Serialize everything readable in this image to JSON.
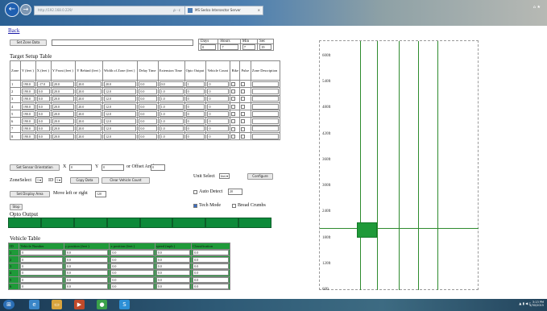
{
  "browser": {
    "address": "http://192.168.0.229/",
    "address_controls": "ρ - c",
    "tab_title": "MS Sedco Intersector Server",
    "tab_close": "×",
    "back_glyph": "←",
    "forward_glyph": "→",
    "window_controls": "⌂ ★"
  },
  "page": {
    "back_link": "Back",
    "set_zone_data_label": "Set Zone Data",
    "zone_data_value": "",
    "time_headers": [
      "Days",
      "Hours",
      "Min",
      "Sec"
    ],
    "time_values": [
      "0",
      "7",
      "7",
      "19"
    ],
    "target_setup_title": "Target Setup Table",
    "target_headers": [
      "Zone",
      "Y (feet )",
      "X (feet )",
      "Y Front (feet )",
      "Y Behind (feet )",
      "Width of Zone (feet )",
      "Delay Time",
      "Extension Time",
      "Opto Output",
      "Vehicle Count",
      "Bike",
      "Pulse",
      "Zone Description"
    ],
    "target_rows": [
      {
        "zone": "1",
        "y": "190.0",
        "x": "-17.0",
        "yfront": "20.0",
        "ybehind": "20.0",
        "width": "20.0",
        "delay": "0.0",
        "ext": "0.0",
        "opto": "1",
        "count": "0",
        "desc": ""
      },
      {
        "zone": "2",
        "y": "190.0",
        "x": "0.0",
        "yfront": "20.0",
        "ybehind": "20.0",
        "width": "12.0",
        "delay": "0.0",
        "ext": "1.0",
        "opto": "0",
        "count": "0",
        "desc": ""
      },
      {
        "zone": "3",
        "y": "190.0",
        "x": "0.0",
        "yfront": "20.0",
        "ybehind": "20.0",
        "width": "12.0",
        "delay": "0.0",
        "ext": "1.0",
        "opto": "0",
        "count": "0",
        "desc": ""
      },
      {
        "zone": "4",
        "y": "190.0",
        "x": "0.0",
        "yfront": "20.0",
        "ybehind": "20.0",
        "width": "12.0",
        "delay": "0.0",
        "ext": "1.0",
        "opto": "0",
        "count": "0",
        "desc": ""
      },
      {
        "zone": "5",
        "y": "190.0",
        "x": "0.0",
        "yfront": "20.0",
        "ybehind": "20.0",
        "width": "12.0",
        "delay": "0.0",
        "ext": "1.0",
        "opto": "0",
        "count": "0",
        "desc": ""
      },
      {
        "zone": "6",
        "y": "190.0",
        "x": "0.0",
        "yfront": "20.0",
        "ybehind": "20.0",
        "width": "12.0",
        "delay": "0.0",
        "ext": "1.0",
        "opto": "0",
        "count": "0",
        "desc": ""
      },
      {
        "zone": "7",
        "y": "190.0",
        "x": "0.0",
        "yfront": "20.0",
        "ybehind": "20.0",
        "width": "12.0",
        "delay": "0.0",
        "ext": "1.0",
        "opto": "0",
        "count": "0",
        "desc": ""
      },
      {
        "zone": "8",
        "y": "190.0",
        "x": "0.0",
        "yfront": "20.0",
        "ybehind": "20.0",
        "width": "12.0",
        "delay": "0.0",
        "ext": "1.0",
        "opto": "0",
        "count": "0",
        "desc": ""
      }
    ],
    "sensor_orientation_btn": "Set Sensor Orientation",
    "x_label": "X",
    "x_value": "0",
    "y_label": "Y",
    "y_value": "0",
    "offset_label": "or Offset Angle",
    "offset_value": "0",
    "zone_select_label": "ZoneSelect",
    "zone_select_value": "1",
    "id_label": "ID",
    "id_value": "1",
    "copy_data_btn": "Copy Data",
    "clear_vehicle_btn": "Clear Vehicle Count",
    "unit_select_label": "Unit Select",
    "unit_select_value": "feet",
    "configure_btn": "Configure",
    "auto_detect_label": "Auto Detect",
    "auto_detect_value": "20",
    "set_display_area_btn": "Set Display Area",
    "move_label": "Move left or right",
    "move_value": "120",
    "tech_mode_label": "Tech Mode",
    "bread_crumbs_label": "Bread Crumbs",
    "stop_btn": "Stop",
    "opto_output_title": "Opto Output",
    "opto_count": 8,
    "vehicle_table_title": "Vehicle Table",
    "vehicle_headers": [
      "ID",
      "Vehicle Number",
      "y position (feet )",
      "x position (feet )",
      "speed (mph )",
      "Classification"
    ],
    "vehicle_rows": [
      {
        "id": "1",
        "num": "0",
        "ypos": "0.0",
        "xpos": "0.0",
        "speed": "0.0",
        "cls": "0.0"
      },
      {
        "id": "2",
        "num": "0",
        "ypos": "0.0",
        "xpos": "0.0",
        "speed": "0.0",
        "cls": "0.0"
      },
      {
        "id": "3",
        "num": "0",
        "ypos": "0.0",
        "xpos": "0.0",
        "speed": "0.0",
        "cls": "0.0"
      },
      {
        "id": "4",
        "num": "0",
        "ypos": "0.0",
        "xpos": "0.0",
        "speed": "0.0",
        "cls": "0.0"
      },
      {
        "id": "5",
        "num": "0",
        "ypos": "0.0",
        "xpos": "0.0",
        "speed": "0.0",
        "cls": "0.0"
      },
      {
        "id": "6",
        "num": "0",
        "ypos": "0.0",
        "xpos": "0.0",
        "speed": "0.0",
        "cls": "0.0"
      }
    ]
  },
  "display": {
    "range_labels": [
      "600ft",
      "540ft",
      "480ft",
      "420ft",
      "360ft",
      "300ft",
      "240ft",
      "180ft",
      "120ft",
      "60ft"
    ],
    "lane_color": "#2e8b2e",
    "vehicle_color": "#1f9a39"
  },
  "taskbar": {
    "icons": [
      "start-orb-icon",
      "ie-icon",
      "explorer-icon",
      "media-icon",
      "chrome-icon",
      "app-icon"
    ],
    "tray_icons": "▲ ▮ ◀ ♪",
    "clock_time": "3:13 PM",
    "clock_date": "4/30/2015"
  }
}
